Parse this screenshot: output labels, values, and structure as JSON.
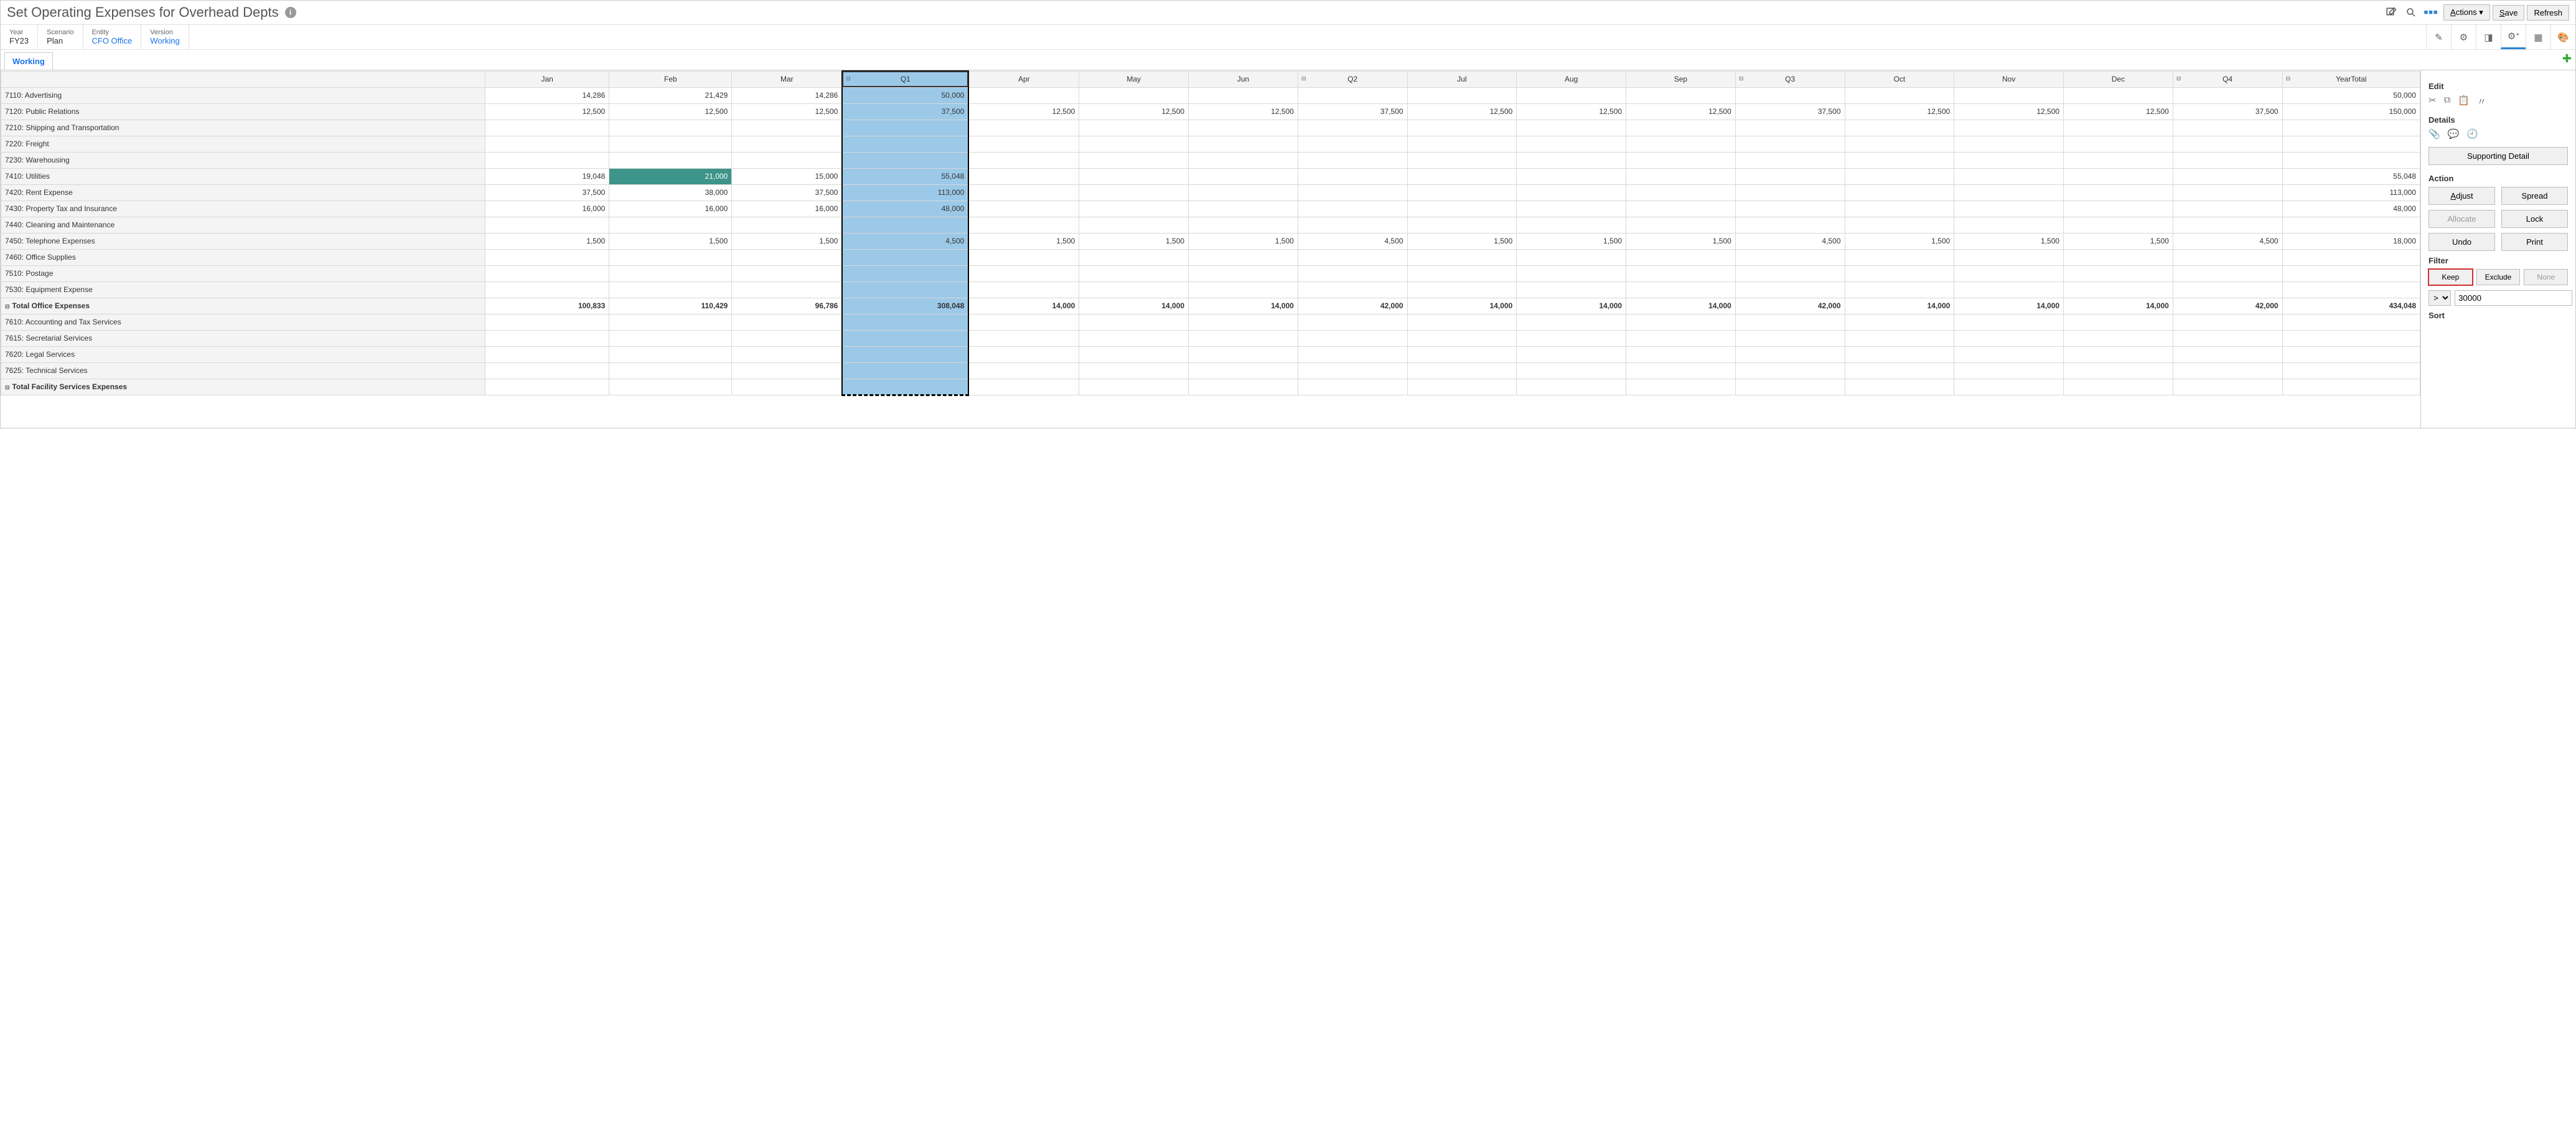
{
  "header": {
    "title": "Set Operating Expenses for Overhead Depts",
    "actions_label": "Actions",
    "save_label": "Save",
    "refresh_label": "Refresh"
  },
  "pov": {
    "year_label": "Year",
    "year_value": "FY23",
    "scenario_label": "Scenario",
    "scenario_value": "Plan",
    "entity_label": "Entity",
    "entity_value": "CFO Office",
    "version_label": "Version",
    "version_value": "Working"
  },
  "tab": {
    "working": "Working"
  },
  "columns": [
    "Jan",
    "Feb",
    "Mar",
    "Q1",
    "Apr",
    "May",
    "Jun",
    "Q2",
    "Jul",
    "Aug",
    "Sep",
    "Q3",
    "Oct",
    "Nov",
    "Dec",
    "Q4",
    "YearTotal"
  ],
  "quarter_cols": [
    3,
    7,
    11,
    15,
    16
  ],
  "selected_col": 3,
  "rows": [
    {
      "label": "7110: Advertising",
      "cells": [
        "14,286",
        "21,429",
        "14,286",
        "50,000",
        "",
        "",
        "",
        "",
        "",
        "",
        "",
        "",
        "",
        "",
        "",
        "",
        "50,000"
      ]
    },
    {
      "label": "7120: Public Relations",
      "cells": [
        "12,500",
        "12,500",
        "12,500",
        "37,500",
        "12,500",
        "12,500",
        "12,500",
        "37,500",
        "12,500",
        "12,500",
        "12,500",
        "37,500",
        "12,500",
        "12,500",
        "12,500",
        "37,500",
        "150,000"
      ]
    },
    {
      "label": "7210: Shipping and Transportation",
      "cells": [
        "",
        "",
        "",
        "",
        "",
        "",
        "",
        "",
        "",
        "",
        "",
        "",
        "",
        "",
        "",
        "",
        ""
      ]
    },
    {
      "label": "7220: Freight",
      "cells": [
        "",
        "",
        "",
        "",
        "",
        "",
        "",
        "",
        "",
        "",
        "",
        "",
        "",
        "",
        "",
        "",
        ""
      ]
    },
    {
      "label": "7230: Warehousing",
      "cells": [
        "",
        "",
        "",
        "",
        "",
        "",
        "",
        "",
        "",
        "",
        "",
        "",
        "",
        "",
        "",
        "",
        ""
      ]
    },
    {
      "label": "7410: Utilities",
      "cells": [
        "19,048",
        "21,000",
        "15,000",
        "55,048",
        "",
        "",
        "",
        "",
        "",
        "",
        "",
        "",
        "",
        "",
        "",
        "",
        "55,048"
      ],
      "dirty_col": 1
    },
    {
      "label": "7420: Rent Expense",
      "cells": [
        "37,500",
        "38,000",
        "37,500",
        "113,000",
        "",
        "",
        "",
        "",
        "",
        "",
        "",
        "",
        "",
        "",
        "",
        "",
        "113,000"
      ]
    },
    {
      "label": "7430: Property Tax and Insurance",
      "cells": [
        "16,000",
        "16,000",
        "16,000",
        "48,000",
        "",
        "",
        "",
        "",
        "",
        "",
        "",
        "",
        "",
        "",
        "",
        "",
        "48,000"
      ]
    },
    {
      "label": "7440: Cleaning and Maintenance",
      "cells": [
        "",
        "",
        "",
        "",
        "",
        "",
        "",
        "",
        "",
        "",
        "",
        "",
        "",
        "",
        "",
        "",
        ""
      ]
    },
    {
      "label": "7450: Telephone Expenses",
      "cells": [
        "1,500",
        "1,500",
        "1,500",
        "4,500",
        "1,500",
        "1,500",
        "1,500",
        "4,500",
        "1,500",
        "1,500",
        "1,500",
        "4,500",
        "1,500",
        "1,500",
        "1,500",
        "4,500",
        "18,000"
      ]
    },
    {
      "label": "7460: Office Supplies",
      "cells": [
        "",
        "",
        "",
        "",
        "",
        "",
        "",
        "",
        "",
        "",
        "",
        "",
        "",
        "",
        "",
        "",
        ""
      ]
    },
    {
      "label": "7510: Postage",
      "cells": [
        "",
        "",
        "",
        "",
        "",
        "",
        "",
        "",
        "",
        "",
        "",
        "",
        "",
        "",
        "",
        "",
        ""
      ]
    },
    {
      "label": "7530: Equipment Expense",
      "cells": [
        "",
        "",
        "",
        "",
        "",
        "",
        "",
        "",
        "",
        "",
        "",
        "",
        "",
        "",
        "",
        "",
        ""
      ]
    },
    {
      "label": "Total Office Expenses",
      "expandable": true,
      "cells": [
        "100,833",
        "110,429",
        "96,786",
        "308,048",
        "14,000",
        "14,000",
        "14,000",
        "42,000",
        "14,000",
        "14,000",
        "14,000",
        "42,000",
        "14,000",
        "14,000",
        "14,000",
        "42,000",
        "434,048"
      ]
    },
    {
      "label": "7610: Accounting and Tax Services",
      "cells": [
        "",
        "",
        "",
        "",
        "",
        "",
        "",
        "",
        "",
        "",
        "",
        "",
        "",
        "",
        "",
        "",
        ""
      ]
    },
    {
      "label": "7615: Secretarial Services",
      "cells": [
        "",
        "",
        "",
        "",
        "",
        "",
        "",
        "",
        "",
        "",
        "",
        "",
        "",
        "",
        "",
        "",
        ""
      ]
    },
    {
      "label": "7620: Legal Services",
      "cells": [
        "",
        "",
        "",
        "",
        "",
        "",
        "",
        "",
        "",
        "",
        "",
        "",
        "",
        "",
        "",
        "",
        ""
      ]
    },
    {
      "label": "7625: Technical Services",
      "cells": [
        "",
        "",
        "",
        "",
        "",
        "",
        "",
        "",
        "",
        "",
        "",
        "",
        "",
        "",
        "",
        "",
        ""
      ]
    },
    {
      "label": "Total Facility Services Expenses",
      "expandable": true,
      "cells": [
        "",
        "",
        "",
        "",
        "",
        "",
        "",
        "",
        "",
        "",
        "",
        "",
        "",
        "",
        "",
        "",
        ""
      ]
    }
  ],
  "side": {
    "edit": "Edit",
    "details": "Details",
    "supporting_detail": "Supporting Detail",
    "action": "Action",
    "adjust": "Adjust",
    "spread": "Spread",
    "allocate": "Allocate",
    "lock": "Lock",
    "undo": "Undo",
    "print": "Print",
    "filter": "Filter",
    "keep": "Keep",
    "exclude": "Exclude",
    "none": "None",
    "filter_op": ">",
    "filter_val": "30000",
    "sort": "Sort"
  }
}
